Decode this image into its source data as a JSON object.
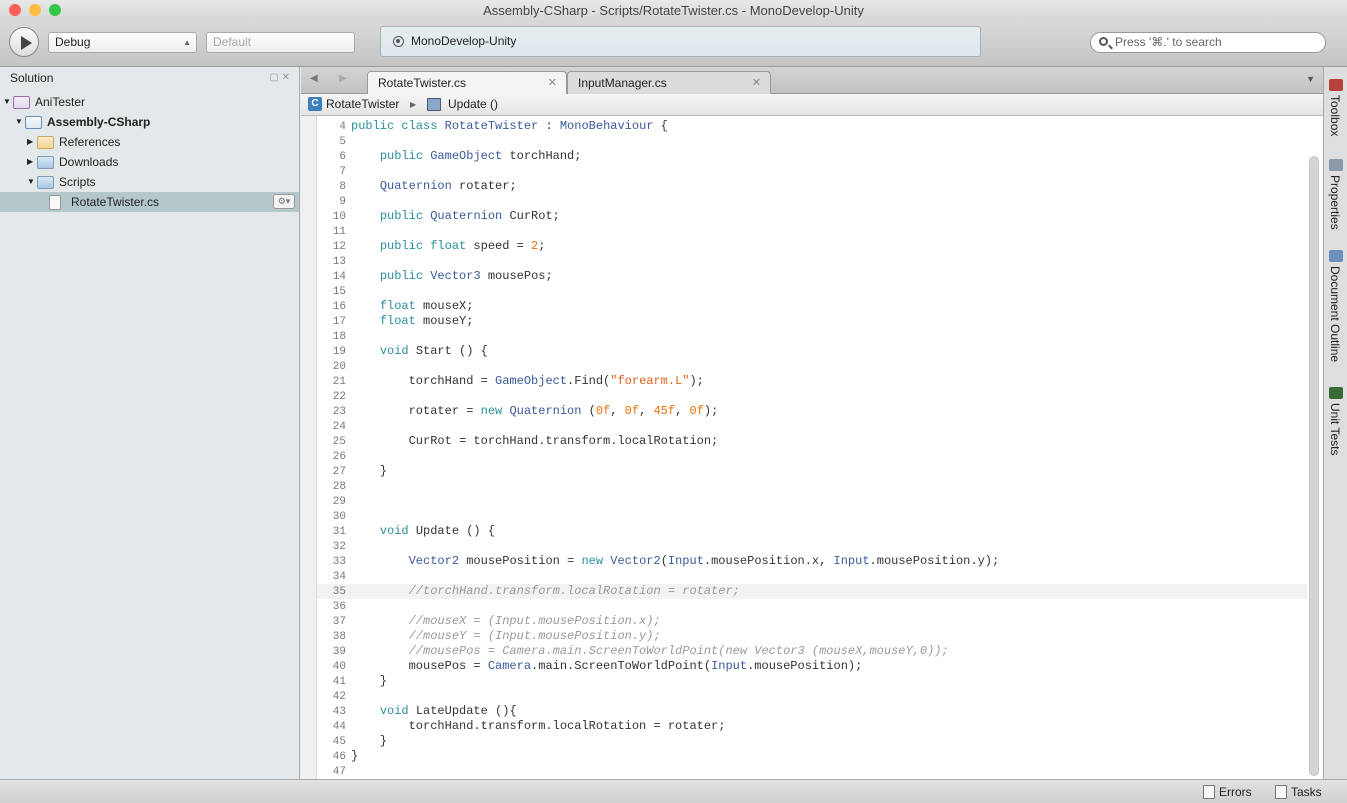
{
  "window": {
    "title": "Assembly-CSharp - Scripts/RotateTwister.cs - MonoDevelop-Unity",
    "traffic_lights": [
      "#fc605c",
      "#fdbc40",
      "#34c84a"
    ]
  },
  "toolbar": {
    "config": "Debug",
    "platform": "Default",
    "status": "MonoDevelop-Unity",
    "search_placeholder": "Press '⌘.' to search"
  },
  "solution": {
    "title": "Solution",
    "items": [
      {
        "label": "AniTester",
        "expanded": true,
        "icon": "solution-icon"
      },
      {
        "label": "Assembly-CSharp",
        "expanded": true,
        "icon": "project-icon"
      },
      {
        "label": "References",
        "expanded": false,
        "icon": "folder-icon"
      },
      {
        "label": "Downloads",
        "expanded": false,
        "icon": "folder-icon"
      },
      {
        "label": "Scripts",
        "expanded": true,
        "icon": "folder-icon"
      },
      {
        "label": "RotateTwister.cs",
        "icon": "cs-file-icon",
        "selected": true
      }
    ]
  },
  "tabs": [
    {
      "label": "RotateTwister.cs",
      "active": true
    },
    {
      "label": "InputManager.cs",
      "active": false
    }
  ],
  "breadcrumb": {
    "class": "RotateTwister",
    "method": "Update ()"
  },
  "editor": {
    "current_line": 35,
    "lines": [
      {
        "n": 4,
        "t": [
          [
            "kw",
            "public class "
          ],
          [
            "ty",
            "RotateTwister"
          ],
          [
            "pl",
            " : "
          ],
          [
            "ty",
            "MonoBehaviour"
          ],
          [
            "pl",
            " {"
          ]
        ]
      },
      {
        "n": 5,
        "t": []
      },
      {
        "n": 6,
        "t": [
          [
            "pl",
            "    "
          ],
          [
            "kw",
            "public "
          ],
          [
            "ty",
            "GameObject"
          ],
          [
            "pl",
            " torchHand;"
          ]
        ]
      },
      {
        "n": 7,
        "t": []
      },
      {
        "n": 8,
        "t": [
          [
            "pl",
            "    "
          ],
          [
            "ty",
            "Quaternion"
          ],
          [
            "pl",
            " rotater;"
          ]
        ]
      },
      {
        "n": 9,
        "t": []
      },
      {
        "n": 10,
        "t": [
          [
            "pl",
            "    "
          ],
          [
            "kw",
            "public "
          ],
          [
            "ty",
            "Quaternion"
          ],
          [
            "pl",
            " CurRot;"
          ]
        ]
      },
      {
        "n": 11,
        "t": []
      },
      {
        "n": 12,
        "t": [
          [
            "pl",
            "    "
          ],
          [
            "kw",
            "public float"
          ],
          [
            "pl",
            " speed = "
          ],
          [
            "num",
            "2"
          ],
          [
            "pl",
            ";"
          ]
        ]
      },
      {
        "n": 13,
        "t": []
      },
      {
        "n": 14,
        "t": [
          [
            "pl",
            "    "
          ],
          [
            "kw",
            "public "
          ],
          [
            "ty",
            "Vector3"
          ],
          [
            "pl",
            " mousePos;"
          ]
        ]
      },
      {
        "n": 15,
        "t": []
      },
      {
        "n": 16,
        "t": [
          [
            "pl",
            "    "
          ],
          [
            "kw",
            "float"
          ],
          [
            "pl",
            " mouseX;"
          ]
        ]
      },
      {
        "n": 17,
        "t": [
          [
            "pl",
            "    "
          ],
          [
            "kw",
            "float"
          ],
          [
            "pl",
            " mouseY;"
          ]
        ]
      },
      {
        "n": 18,
        "t": []
      },
      {
        "n": 19,
        "t": [
          [
            "pl",
            "    "
          ],
          [
            "kw",
            "void"
          ],
          [
            "pl",
            " Start () {"
          ]
        ]
      },
      {
        "n": 20,
        "t": []
      },
      {
        "n": 21,
        "t": [
          [
            "pl",
            "        torchHand = "
          ],
          [
            "ty",
            "GameObject"
          ],
          [
            "pl",
            ".Find("
          ],
          [
            "str",
            "\"forearm.L\""
          ],
          [
            "pl",
            ");"
          ]
        ]
      },
      {
        "n": 22,
        "t": []
      },
      {
        "n": 23,
        "t": [
          [
            "pl",
            "        rotater = "
          ],
          [
            "kw",
            "new "
          ],
          [
            "ty",
            "Quaternion"
          ],
          [
            "pl",
            " ("
          ],
          [
            "num",
            "0f"
          ],
          [
            "pl",
            ", "
          ],
          [
            "num",
            "0f"
          ],
          [
            "pl",
            ", "
          ],
          [
            "num",
            "45f"
          ],
          [
            "pl",
            ", "
          ],
          [
            "num",
            "0f"
          ],
          [
            "pl",
            ");"
          ]
        ]
      },
      {
        "n": 24,
        "t": []
      },
      {
        "n": 25,
        "t": [
          [
            "pl",
            "        CurRot = torchHand.transform.localRotation;"
          ]
        ]
      },
      {
        "n": 26,
        "t": []
      },
      {
        "n": 27,
        "t": [
          [
            "pl",
            "    }"
          ]
        ]
      },
      {
        "n": 28,
        "t": []
      },
      {
        "n": 29,
        "t": []
      },
      {
        "n": 30,
        "t": []
      },
      {
        "n": 31,
        "t": [
          [
            "pl",
            "    "
          ],
          [
            "kw",
            "void"
          ],
          [
            "pl",
            " Update () {"
          ]
        ]
      },
      {
        "n": 32,
        "t": []
      },
      {
        "n": 33,
        "t": [
          [
            "pl",
            "        "
          ],
          [
            "ty",
            "Vector2"
          ],
          [
            "pl",
            " mousePosition = "
          ],
          [
            "kw",
            "new "
          ],
          [
            "ty",
            "Vector2"
          ],
          [
            "pl",
            "("
          ],
          [
            "ty",
            "Input"
          ],
          [
            "pl",
            ".mousePosition.x, "
          ],
          [
            "ty",
            "Input"
          ],
          [
            "pl",
            ".mousePosition.y);"
          ]
        ]
      },
      {
        "n": 34,
        "t": []
      },
      {
        "n": 35,
        "t": [
          [
            "pl",
            "        "
          ],
          [
            "cm",
            "//torchHand.transform.localRotation = rotater;"
          ]
        ]
      },
      {
        "n": 36,
        "t": []
      },
      {
        "n": 37,
        "t": [
          [
            "pl",
            "        "
          ],
          [
            "cm",
            "//mouseX = (Input.mousePosition.x);"
          ]
        ]
      },
      {
        "n": 38,
        "t": [
          [
            "pl",
            "        "
          ],
          [
            "cm",
            "//mouseY = (Input.mousePosition.y);"
          ]
        ]
      },
      {
        "n": 39,
        "t": [
          [
            "pl",
            "        "
          ],
          [
            "cm",
            "//mousePos = Camera.main.ScreenToWorldPoint(new Vector3 (mouseX,mouseY,0));"
          ]
        ]
      },
      {
        "n": 40,
        "t": [
          [
            "pl",
            "        mousePos = "
          ],
          [
            "ty",
            "Camera"
          ],
          [
            "pl",
            ".main.ScreenToWorldPoint("
          ],
          [
            "ty",
            "Input"
          ],
          [
            "pl",
            ".mousePosition);"
          ]
        ]
      },
      {
        "n": 41,
        "t": [
          [
            "pl",
            "    }"
          ]
        ]
      },
      {
        "n": 42,
        "t": []
      },
      {
        "n": 43,
        "t": [
          [
            "pl",
            "    "
          ],
          [
            "kw",
            "void"
          ],
          [
            "pl",
            " LateUpdate (){"
          ]
        ]
      },
      {
        "n": 44,
        "t": [
          [
            "pl",
            "        torchHand.transform.localRotation = rotater;"
          ]
        ]
      },
      {
        "n": 45,
        "t": [
          [
            "pl",
            "    }"
          ]
        ]
      },
      {
        "n": 46,
        "t": [
          [
            "pl",
            "}"
          ]
        ]
      },
      {
        "n": 47,
        "t": []
      }
    ]
  },
  "right_pads": [
    {
      "label": "Toolbox",
      "icon": "toolbox-icon"
    },
    {
      "label": "Properties",
      "icon": "properties-icon"
    },
    {
      "label": "Document Outline",
      "icon": "document-outline-icon"
    },
    {
      "label": "Unit Tests",
      "icon": "unit-tests-icon"
    }
  ],
  "statusbar": {
    "errors": "Errors",
    "tasks": "Tasks"
  }
}
